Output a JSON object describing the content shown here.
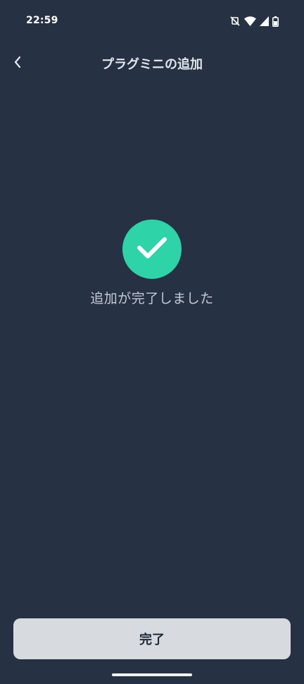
{
  "status_bar": {
    "time": "22:59",
    "icons": [
      "mute-icon",
      "wifi-icon",
      "signal-icon",
      "battery-icon"
    ]
  },
  "header": {
    "back_icon": "chevron-left-icon",
    "title": "プラグミニの追加"
  },
  "main": {
    "success_icon": "checkmark-icon",
    "message": "追加が完了しました"
  },
  "footer": {
    "done_label": "完了"
  },
  "colors": {
    "background": "#263243",
    "accent": "#2ed3a8",
    "button": "#d7dbdf"
  }
}
